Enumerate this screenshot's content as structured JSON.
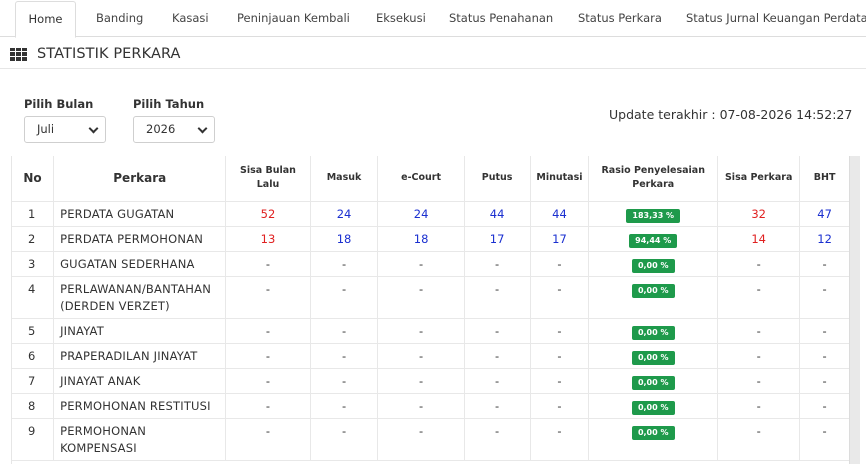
{
  "tabs": [
    "Home",
    "Banding",
    "Kasasi",
    "Peninjauan Kembali",
    "Eksekusi",
    "Status Penahanan",
    "Status Perkara",
    "Status Jurnal Keuangan Perdata"
  ],
  "section_title": "STATISTIK PERKARA",
  "filters": {
    "bulan_label": "Pilih Bulan",
    "bulan_value": "Juli",
    "tahun_label": "Pilih Tahun",
    "tahun_value": "2026"
  },
  "update_text": "Update terakhir : 07-08-2026 14:52:27",
  "table": {
    "headers": [
      "No",
      "Perkara",
      "Sisa Bulan Lalu",
      "Masuk",
      "e-Court",
      "Putus",
      "Minutasi",
      "Rasio Penyelesaian Perkara",
      "Sisa Perkara",
      "BHT"
    ],
    "rows": [
      {
        "no": "1",
        "perkara": "PERDATA GUGATAN",
        "sisa_lalu": "52",
        "masuk": "24",
        "ecourt": "24",
        "putus": "44",
        "minutasi": "44",
        "rasio": "183,33 %",
        "sisa": "32",
        "bht": "47"
      },
      {
        "no": "2",
        "perkara": "PERDATA PERMOHONAN",
        "sisa_lalu": "13",
        "masuk": "18",
        "ecourt": "18",
        "putus": "17",
        "minutasi": "17",
        "rasio": "94,44 %",
        "sisa": "14",
        "bht": "12"
      },
      {
        "no": "3",
        "perkara": "GUGATAN SEDERHANA",
        "sisa_lalu": "-",
        "masuk": "-",
        "ecourt": "-",
        "putus": "-",
        "minutasi": "-",
        "rasio": "0,00 %",
        "sisa": "-",
        "bht": "-"
      },
      {
        "no": "4",
        "perkara": "PERLAWANAN/BANTAHAN (DERDEN VERZET)",
        "sisa_lalu": "-",
        "masuk": "-",
        "ecourt": "-",
        "putus": "-",
        "minutasi": "-",
        "rasio": "0,00 %",
        "sisa": "-",
        "bht": "-"
      },
      {
        "no": "5",
        "perkara": "JINAYAT",
        "sisa_lalu": "-",
        "masuk": "-",
        "ecourt": "-",
        "putus": "-",
        "minutasi": "-",
        "rasio": "0,00 %",
        "sisa": "-",
        "bht": "-"
      },
      {
        "no": "6",
        "perkara": "PRAPERADILAN JINAYAT",
        "sisa_lalu": "-",
        "masuk": "-",
        "ecourt": "-",
        "putus": "-",
        "minutasi": "-",
        "rasio": "0,00 %",
        "sisa": "-",
        "bht": "-"
      },
      {
        "no": "7",
        "perkara": "JINAYAT ANAK",
        "sisa_lalu": "-",
        "masuk": "-",
        "ecourt": "-",
        "putus": "-",
        "minutasi": "-",
        "rasio": "0,00 %",
        "sisa": "-",
        "bht": "-"
      },
      {
        "no": "8",
        "perkara": "PERMOHONAN RESTITUSI",
        "sisa_lalu": "-",
        "masuk": "-",
        "ecourt": "-",
        "putus": "-",
        "minutasi": "-",
        "rasio": "0,00 %",
        "sisa": "-",
        "bht": "-"
      },
      {
        "no": "9",
        "perkara": "PERMOHONAN KOMPENSASI",
        "sisa_lalu": "-",
        "masuk": "-",
        "ecourt": "-",
        "putus": "-",
        "minutasi": "-",
        "rasio": "0,00 %",
        "sisa": "-",
        "bht": "-"
      }
    ]
  },
  "colors": {
    "accent_green": "#1e9a4b",
    "value_red": "#e02020",
    "value_blue": "#1a2fd0"
  },
  "icons": {
    "section": "grid-icon",
    "select": "chevron-down-icon"
  }
}
